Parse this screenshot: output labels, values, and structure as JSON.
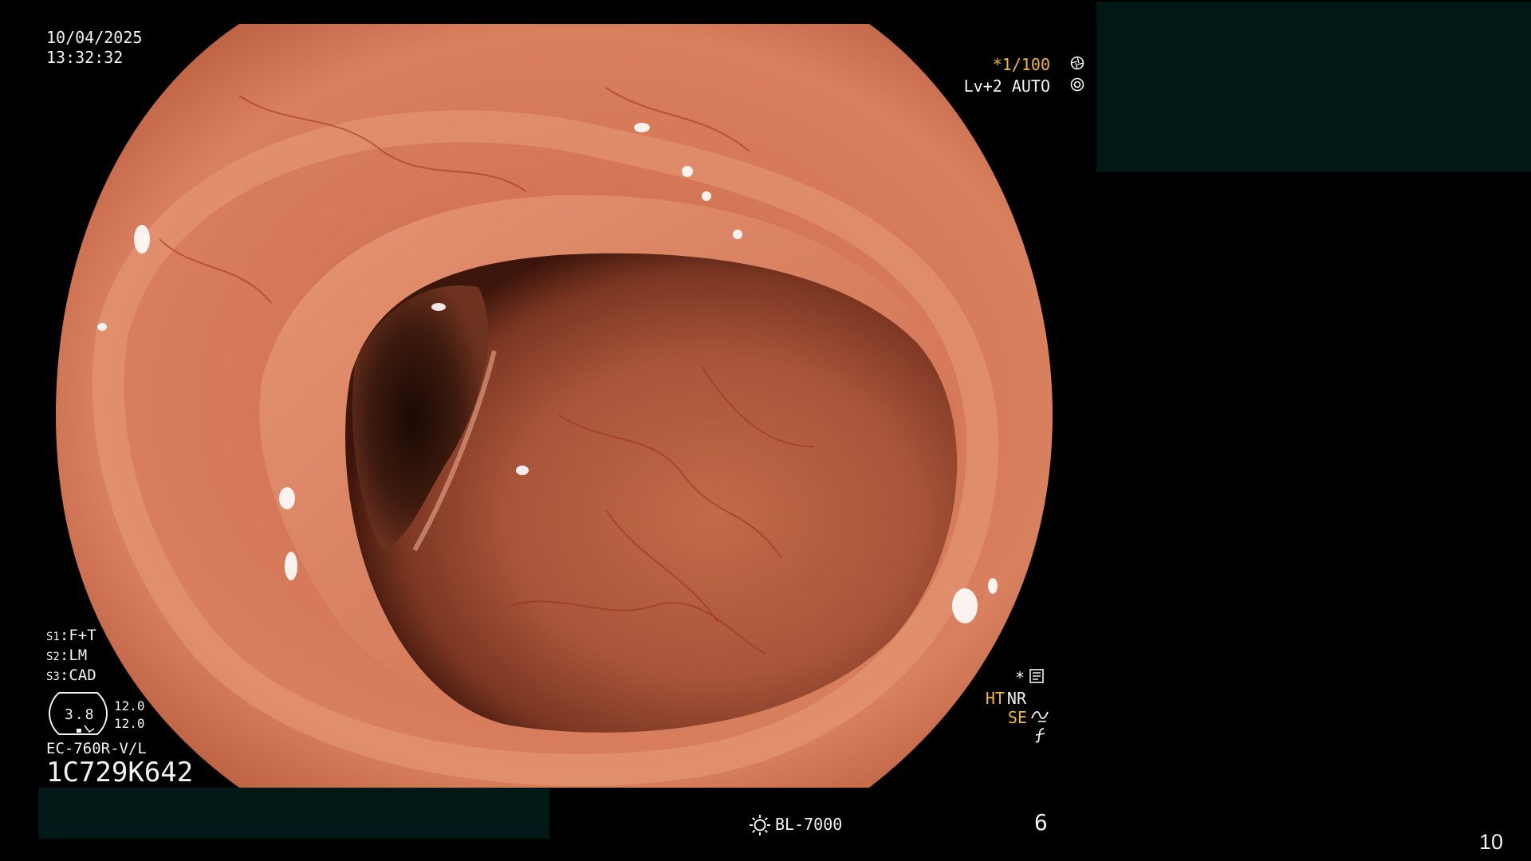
{
  "overlay": {
    "date": "10/04/2025",
    "time": "13:32:32",
    "shutter": "*1/100",
    "shutter_icon": "shutter-icon",
    "level": "Lv+2 AUTO",
    "level_icon": "iris-icon",
    "scope_settings": [
      {
        "prefix": "S1",
        "value": "F+T"
      },
      {
        "prefix": "S2",
        "value": "LM"
      },
      {
        "prefix": "S3",
        "value": "CAD"
      }
    ],
    "zoom_value": "3.8",
    "zoom_a": "12.0",
    "zoom_b": "12.0",
    "scope_model": "EC-760R-V/L",
    "serial": "1C729K642",
    "mode_asterisk": "*",
    "mode_icon": "screen-icon",
    "ht": "HT",
    "nr": "NR",
    "se": "SE",
    "se_icon": "signal-enhance-icon",
    "f_icon": "freeze-off-icon",
    "light_source": "BL-7000",
    "light_icon": "light-source-icon",
    "frame_number": "6",
    "page_number": "10"
  },
  "colors": {
    "background": "#000000",
    "osd_text": "#f2f2f2",
    "osd_accent": "#f5b82a",
    "redaction": "#011816",
    "mucosa": "#cf6b4a"
  }
}
